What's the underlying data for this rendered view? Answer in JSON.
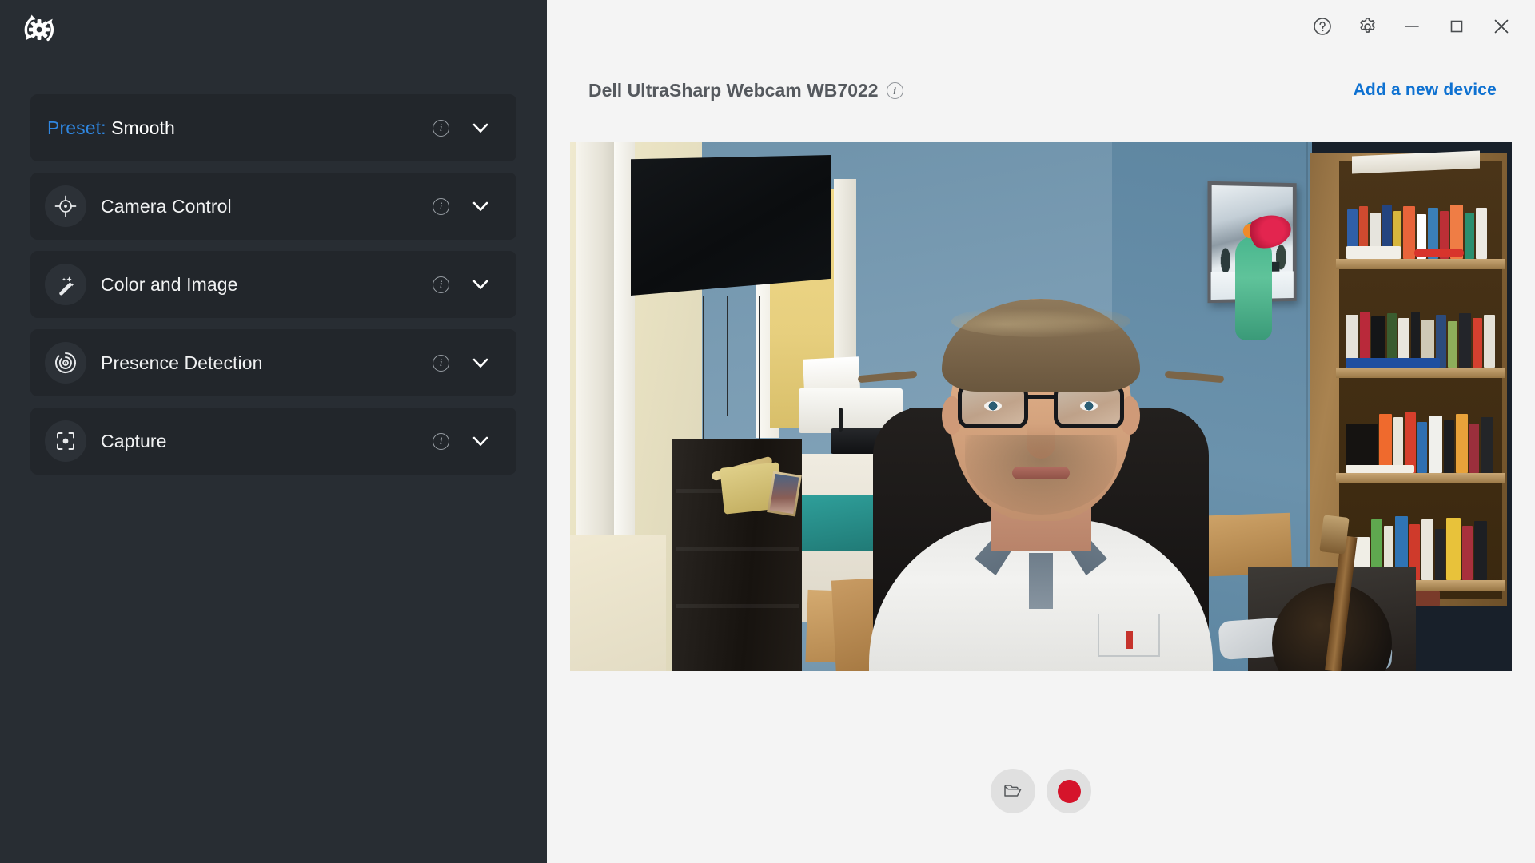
{
  "app": {
    "logo_icon": "gear-refresh-logo",
    "accent_blue": "#2f86e0",
    "link_blue": "#0e71d1",
    "sidebar_bg": "#282d33",
    "row_bg": "#22262b",
    "main_bg": "#f4f4f4",
    "record_red": "#d5142b"
  },
  "sidebar": {
    "preset": {
      "key_label": "Preset:",
      "value_label": "Smooth",
      "info_glyph": "i",
      "chevron_icon": "chevron-down-icon"
    },
    "items": [
      {
        "label": "Camera Control",
        "icon": "crosshair-icon",
        "info_glyph": "i",
        "chevron_icon": "chevron-down-icon"
      },
      {
        "label": "Color and Image",
        "icon": "magic-wand-icon",
        "info_glyph": "i",
        "chevron_icon": "chevron-down-icon"
      },
      {
        "label": "Presence Detection",
        "icon": "radar-target-icon",
        "info_glyph": "i",
        "chevron_icon": "chevron-down-icon"
      },
      {
        "label": "Capture",
        "icon": "focus-frame-icon",
        "info_glyph": "i",
        "chevron_icon": "chevron-down-icon"
      }
    ]
  },
  "titlebar": {
    "buttons": [
      {
        "name": "help",
        "icon": "question-circle-icon"
      },
      {
        "name": "settings",
        "icon": "gear-icon"
      },
      {
        "name": "minimize",
        "icon": "minimize-icon"
      },
      {
        "name": "maximize",
        "icon": "maximize-icon"
      },
      {
        "name": "close",
        "icon": "close-icon"
      }
    ]
  },
  "device": {
    "name": "Dell UltraSharp Webcam WB7022",
    "info_glyph": "i",
    "add_device_label": "Add a new device"
  },
  "preview": {
    "alt": "Live webcam preview: man with glasses in white polo shirt seated in a home office with blue walls, wall-mounted TV, bookshelf, framed snow photo and guitar"
  },
  "actions": [
    {
      "name": "open-folder",
      "icon": "folder-icon"
    },
    {
      "name": "record",
      "icon": "record-icon"
    }
  ]
}
